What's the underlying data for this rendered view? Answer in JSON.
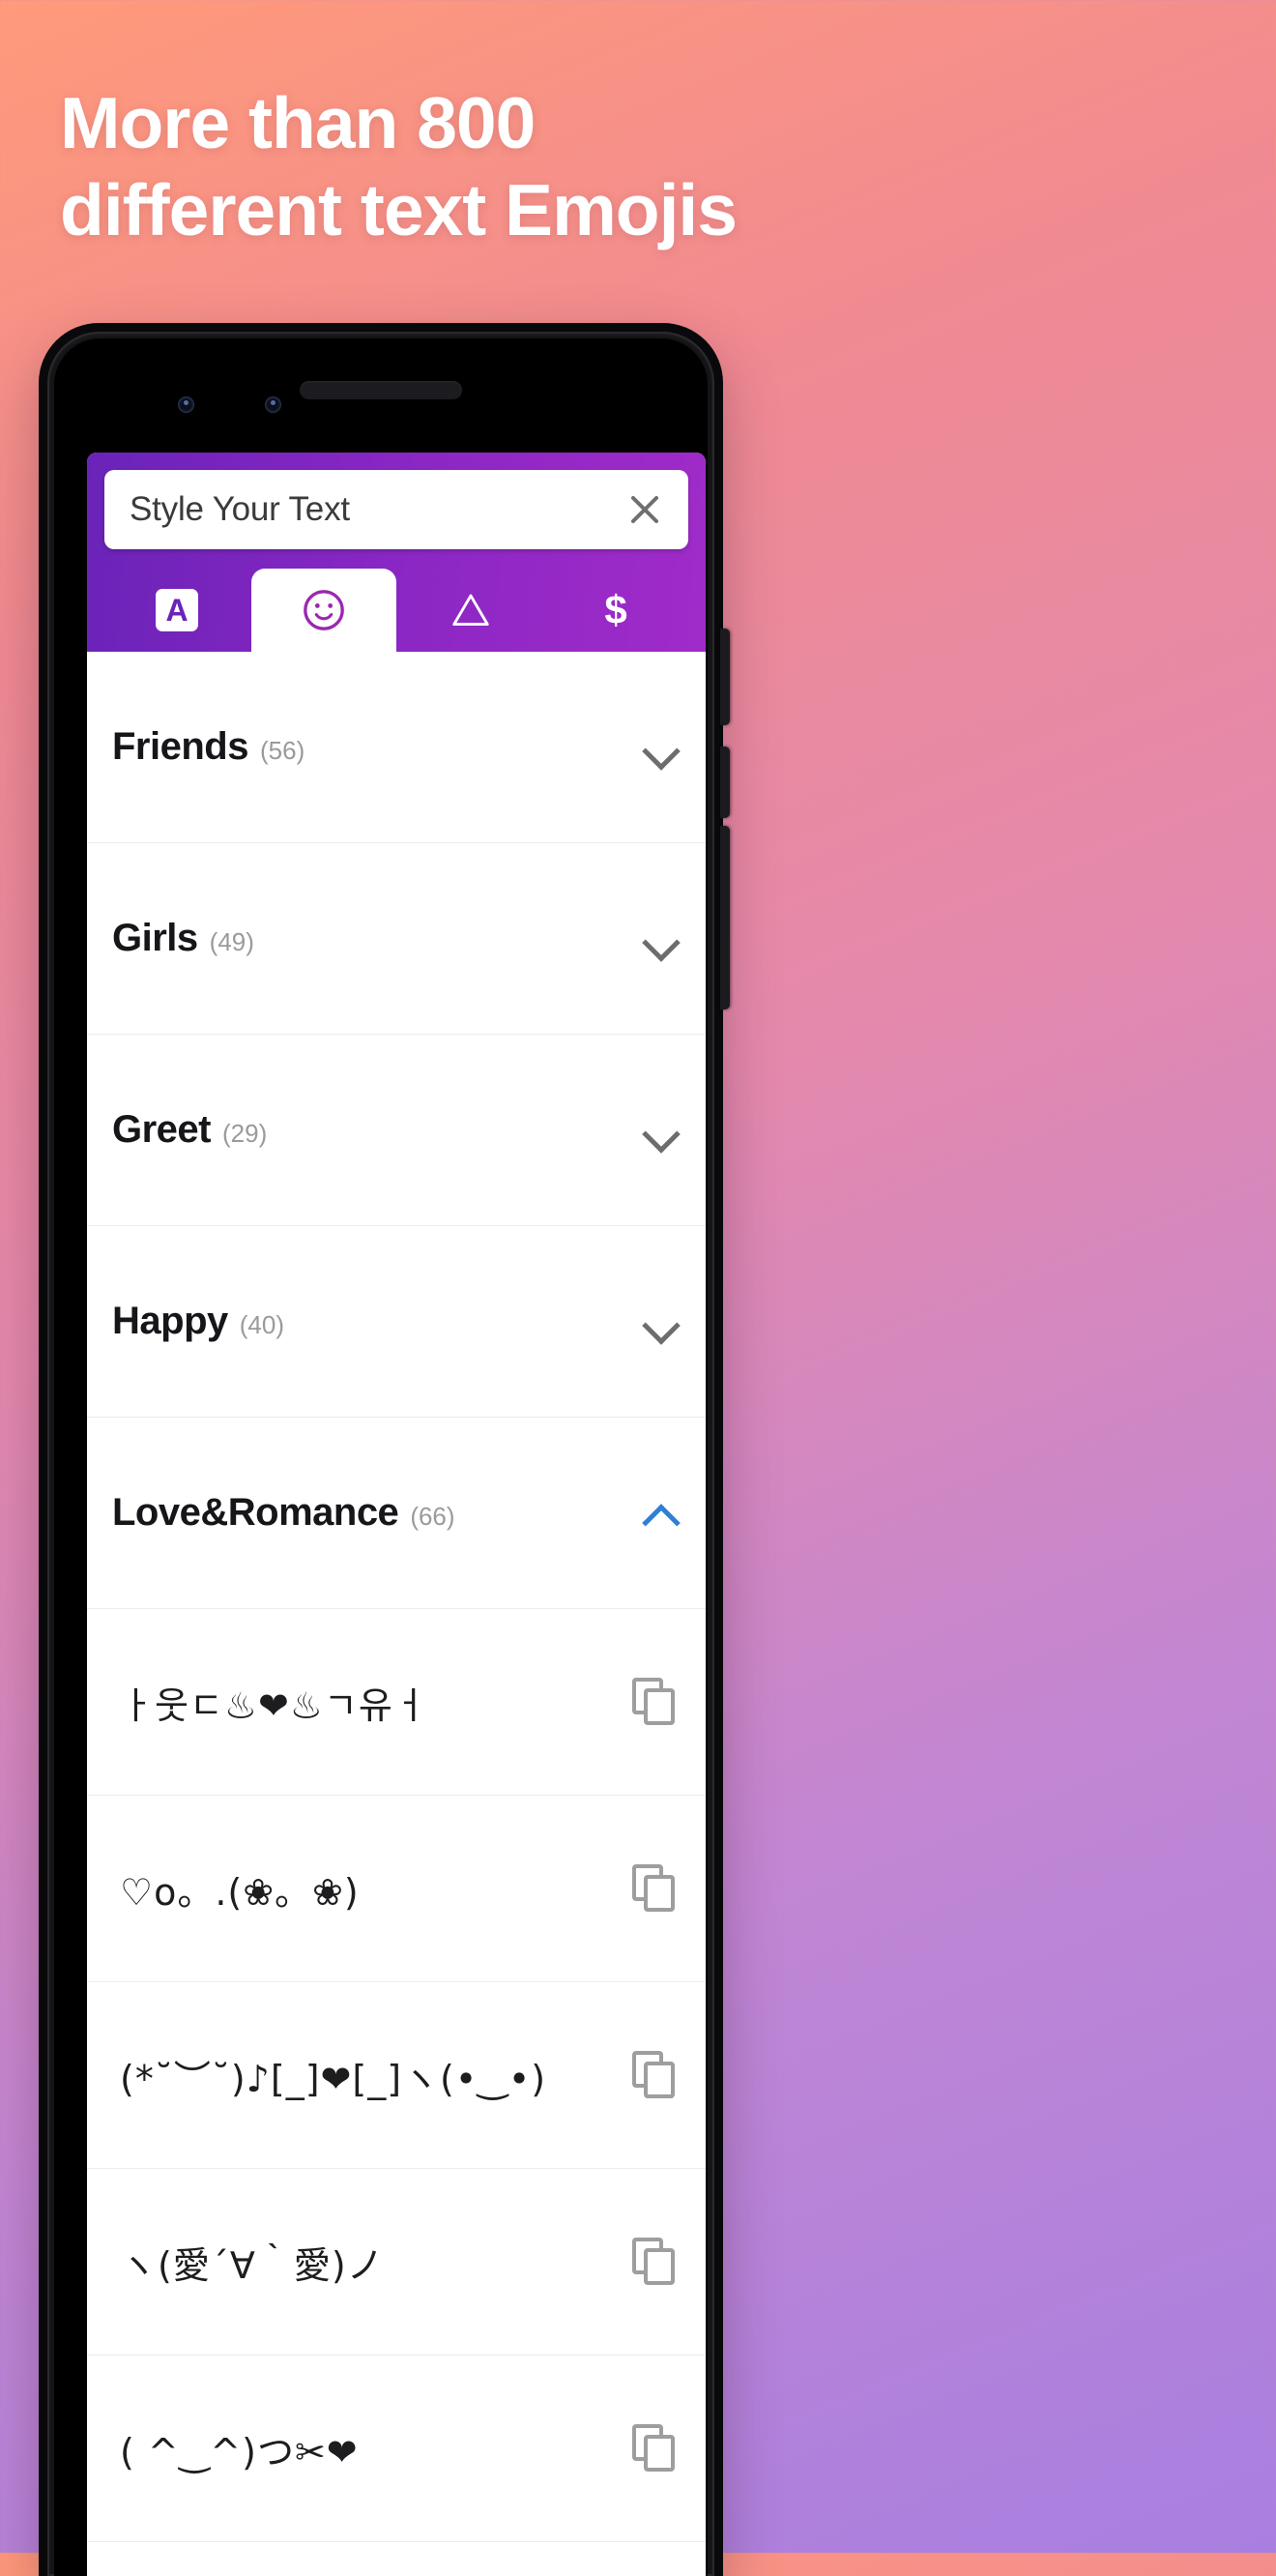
{
  "promo": {
    "headline_line1": "More than 800",
    "headline_line2": "different text Emojis"
  },
  "app": {
    "search": {
      "value": "Style Your Text",
      "placeholder": "Style Your Text",
      "clear_icon": "close-icon"
    },
    "tabs": [
      {
        "id": "text-styles",
        "icon": "letter-a-icon",
        "label": "A",
        "active": false
      },
      {
        "id": "emoji",
        "icon": "smiley-face-icon",
        "label": "",
        "active": true
      },
      {
        "id": "symbols",
        "icon": "triangle-icon",
        "label": "",
        "active": false
      },
      {
        "id": "currency",
        "icon": "dollar-sign-icon",
        "label": "$",
        "active": false
      }
    ],
    "categories": [
      {
        "name": "Friends",
        "count": "(56)",
        "expanded": false
      },
      {
        "name": "Girls",
        "count": "(49)",
        "expanded": false
      },
      {
        "name": "Greet",
        "count": "(29)",
        "expanded": false
      },
      {
        "name": "Happy",
        "count": "(40)",
        "expanded": false
      },
      {
        "name": "Love&Romance",
        "count": "(66)",
        "expanded": true
      }
    ],
    "emojis": [
      {
        "text": "ㅏ웃ㄷ♨❤♨ㄱ유ㅓ",
        "copy_icon": "copy-icon"
      },
      {
        "text": "♡o。.(❀。❀)",
        "copy_icon": "copy-icon"
      },
      {
        "text": "(*˘︶˘)♪[_]❤[_]ヽ(•‿•)",
        "copy_icon": "copy-icon"
      },
      {
        "text": "ヽ(愛´∀｀愛)ノ",
        "copy_icon": "copy-icon"
      },
      {
        "text": "( ^‿^)つ✂❤",
        "copy_icon": "copy-icon"
      }
    ]
  },
  "colors": {
    "header_purple_start": "#6a23b8",
    "header_purple_end": "#a02bc9",
    "accent_blue": "#2f7fd4",
    "heart_red": "#e8302f",
    "bg_gradient_start": "#ff9a7a",
    "bg_gradient_end": "#a87fe0"
  }
}
